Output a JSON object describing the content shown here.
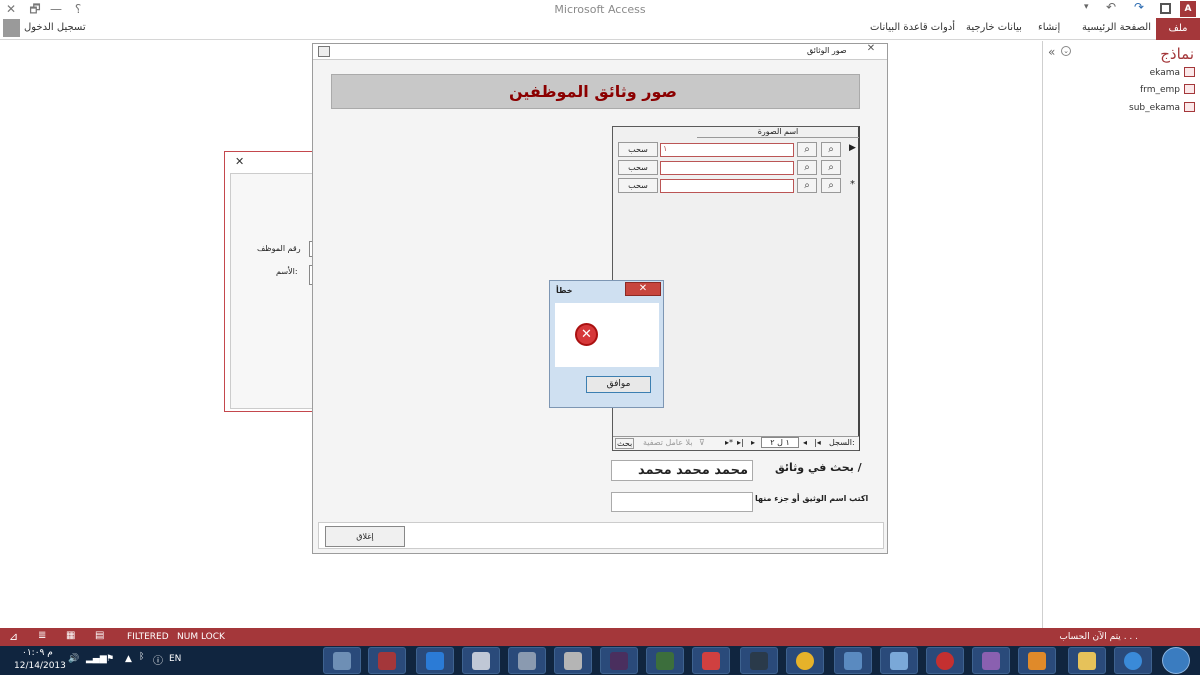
{
  "app": {
    "title": "Microsoft Access",
    "sign_in": "تسجيل الدخول",
    "help": "؟",
    "minimize": "—",
    "restore": "🗗",
    "close": "✕"
  },
  "ribbon": {
    "file": "ملف",
    "tabs": [
      "الصفحة الرئيسية",
      "إنشاء",
      "بيانات خارجية",
      "أدوات قاعدة البيانات"
    ]
  },
  "nav": {
    "collapse": "«",
    "menu": "⌄",
    "header": "نماذج",
    "items": [
      "ekama",
      "frm_emp",
      "sub_ekama"
    ]
  },
  "bg_form": {
    "close": "✕",
    "emp_no_label": "رقم الموظف",
    "name_label": "الأسم:"
  },
  "main_form": {
    "title": "صور الوثائق",
    "close": "✕",
    "header": "صور وثائق الموظفين",
    "column_header": "اسم الصورة",
    "rows": [
      {
        "value": "١",
        "pull": "سحب"
      },
      {
        "value": "",
        "pull": "سحب"
      },
      {
        "value": "",
        "pull": "سحب"
      }
    ],
    "record_label": "السجل:",
    "record_pos": "١ ل ٢",
    "filter_label": "بلا عامل تصفية",
    "search_nav": "بحث",
    "search_label": "بحث في وثائق /",
    "search_value": "محمد محمد محمد",
    "hint_label": "اكتب اسم الوثيق أو جزء منها",
    "close_button": "إغلاق"
  },
  "error_dialog": {
    "title": "خطأ",
    "ok": "موافق"
  },
  "status": {
    "filtered": "FILTERED",
    "numlock": "NUM LOCK",
    "message": "يتم الآن الحساب . . ."
  },
  "taskbar": {
    "time": "م ٠١:٠٩",
    "date": "12/14/2013",
    "lang": "EN"
  },
  "colors": {
    "accent": "#a4373a",
    "header_text": "#8b0000"
  }
}
